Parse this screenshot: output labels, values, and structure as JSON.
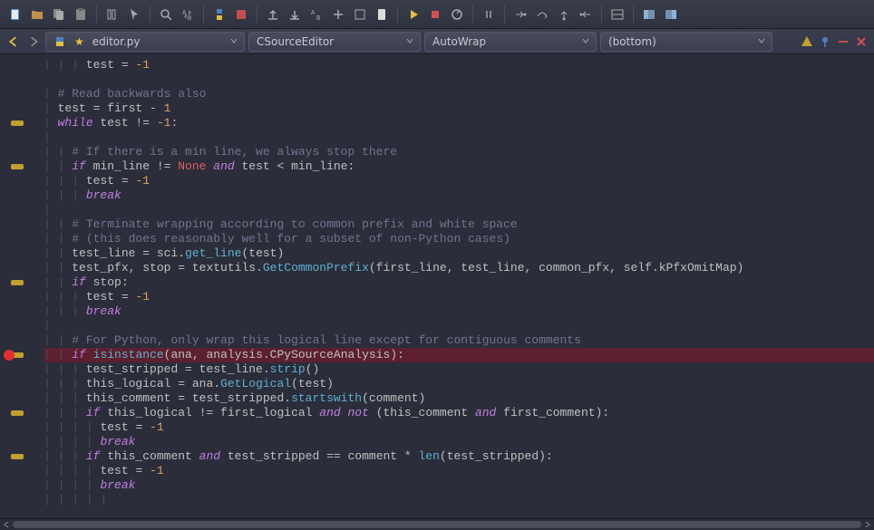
{
  "toolbar": {
    "icons": [
      "new-file-icon",
      "open-folder-icon",
      "copy-icon",
      "paste-icon",
      "sep",
      "indent-icon",
      "cursor-icon",
      "sep",
      "search-icon",
      "replace-icon",
      "sep",
      "python-icon",
      "stop-script-icon",
      "sep",
      "upload-icon",
      "download-icon",
      "find-replace-icon",
      "add-icon",
      "box-icon",
      "page-icon",
      "sep",
      "play-icon",
      "stop-icon",
      "restart-icon",
      "sep",
      "pause-icon",
      "sep",
      "step-into-icon",
      "step-over-icon",
      "step-out-icon",
      "step-return-icon",
      "sep",
      "panels-icon",
      "sep",
      "layout-a-icon",
      "layout-b-icon"
    ]
  },
  "tabbar": {
    "file": "editor.py",
    "editor": "CSourceEditor",
    "wrap": "AutoWrap",
    "position": "(bottom)"
  },
  "code": {
    "lines": [
      {
        "indent": 3,
        "html": "test = <span class='num'>-1</span>"
      },
      {
        "indent": 0,
        "html": ""
      },
      {
        "indent": 1,
        "html": "<span class='cmt'># Read backwards also</span>"
      },
      {
        "indent": 1,
        "html": "test = first - <span class='num'>1</span>"
      },
      {
        "indent": 1,
        "html": "<span class='kw'>while</span> test != <span class='num'>-1</span>:",
        "marker": true
      },
      {
        "indent": 1,
        "html": ""
      },
      {
        "indent": 2,
        "html": "<span class='cmt'># If there is a min line, we always stop there</span>"
      },
      {
        "indent": 2,
        "html": "<span class='kw'>if</span> min_line != <span class='none'>None</span> <span class='kw'>and</span> test &lt; min_line:",
        "marker": true
      },
      {
        "indent": 3,
        "html": "test = <span class='num'>-1</span>"
      },
      {
        "indent": 3,
        "html": "<span class='kwb'>break</span>"
      },
      {
        "indent": 1,
        "html": ""
      },
      {
        "indent": 2,
        "html": "<span class='cmt'># Terminate wrapping according to common prefix and white space</span>"
      },
      {
        "indent": 2,
        "html": "<span class='cmt'># (this does reasonably well for a subset of non-Python cases)</span>"
      },
      {
        "indent": 2,
        "html": "test_line = sci.<span class='fn'>get_line</span>(test)"
      },
      {
        "indent": 2,
        "html": "test_pfx, stop = textutils.<span class='fn'>GetCommonPrefix</span>(first_line, test_line, common_pfx, self.kPfxOmitMap)"
      },
      {
        "indent": 2,
        "html": "<span class='kw'>if</span> stop:",
        "marker": true
      },
      {
        "indent": 3,
        "html": "test = <span class='num'>-1</span>"
      },
      {
        "indent": 3,
        "html": "<span class='kwb'>break</span>"
      },
      {
        "indent": 1,
        "html": ""
      },
      {
        "indent": 2,
        "html": "<span class='cmt'># For Python, only wrap this logical line except for contiguous comments</span>"
      },
      {
        "indent": 2,
        "html": "<span class='kw'>if</span> <span class='fn'>isinstance</span>(ana, analysis.CPySourceAnalysis):",
        "highlight": true,
        "marker": true,
        "bp": true,
        "cursor": true
      },
      {
        "indent": 3,
        "html": "test_stripped = test_line.<span class='fn'>strip</span>()"
      },
      {
        "indent": 3,
        "html": "this_logical = ana.<span class='fn'>GetLogical</span>(test)"
      },
      {
        "indent": 3,
        "html": "this_comment = test_stripped.<span class='fn'>startswith</span>(comment)"
      },
      {
        "indent": 3,
        "html": "<span class='kw'>if</span> this_logical != first_logical <span class='kw'>and</span> <span class='kw'>not</span> (this_comment <span class='kw'>and</span> first_comment):",
        "marker": true
      },
      {
        "indent": 4,
        "html": "test = <span class='num'>-1</span>"
      },
      {
        "indent": 4,
        "html": "<span class='kwb'>break</span>"
      },
      {
        "indent": 3,
        "html": "<span class='kw'>if</span> this_comment <span class='kw'>and</span> test_stripped == comment * <span class='fn'>len</span>(test_stripped):",
        "marker": true
      },
      {
        "indent": 4,
        "html": "test = <span class='num'>-1</span>"
      },
      {
        "indent": 4,
        "html": "<span class='kwb'>break</span>"
      },
      {
        "indent": 5,
        "html": ""
      }
    ]
  }
}
